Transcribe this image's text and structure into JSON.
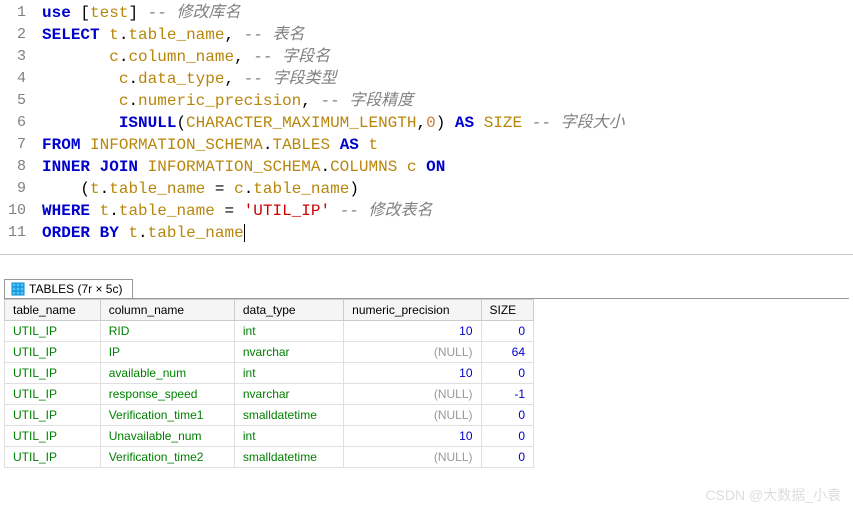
{
  "editor": {
    "lines": [
      {
        "n": 1,
        "tokens": [
          [
            "kw",
            "use "
          ],
          [
            "punct",
            "["
          ],
          [
            "ident",
            "test"
          ],
          [
            "punct",
            "] "
          ],
          [
            "comment",
            "-- 修改库名"
          ]
        ]
      },
      {
        "n": 2,
        "tokens": [
          [
            "kw",
            "SELECT "
          ],
          [
            "ident",
            "t"
          ],
          [
            "punct",
            "."
          ],
          [
            "ident",
            "table_name"
          ],
          [
            "punct",
            ", "
          ],
          [
            "comment",
            "-- 表名"
          ]
        ]
      },
      {
        "n": 3,
        "tokens": [
          [
            "punct",
            "       "
          ],
          [
            "ident",
            "c"
          ],
          [
            "punct",
            "."
          ],
          [
            "ident",
            "column_name"
          ],
          [
            "punct",
            ", "
          ],
          [
            "comment",
            "-- 字段名"
          ]
        ]
      },
      {
        "n": 4,
        "tokens": [
          [
            "punct",
            "        "
          ],
          [
            "ident",
            "c"
          ],
          [
            "punct",
            "."
          ],
          [
            "ident",
            "data_type"
          ],
          [
            "punct",
            ", "
          ],
          [
            "comment",
            "-- 字段类型"
          ]
        ]
      },
      {
        "n": 5,
        "tokens": [
          [
            "punct",
            "        "
          ],
          [
            "ident",
            "c"
          ],
          [
            "punct",
            "."
          ],
          [
            "ident",
            "numeric_precision"
          ],
          [
            "punct",
            ", "
          ],
          [
            "comment",
            "-- 字段精度"
          ]
        ]
      },
      {
        "n": 6,
        "tokens": [
          [
            "punct",
            "        "
          ],
          [
            "kw",
            "ISNULL"
          ],
          [
            "punct",
            "("
          ],
          [
            "ident",
            "CHARACTER_MAXIMUM_LENGTH"
          ],
          [
            "punct",
            ","
          ],
          [
            "num",
            "0"
          ],
          [
            "punct",
            ") "
          ],
          [
            "kw",
            "AS "
          ],
          [
            "ident",
            "SIZE "
          ],
          [
            "comment",
            "-- 字段大小"
          ]
        ]
      },
      {
        "n": 7,
        "tokens": [
          [
            "kw",
            "FROM "
          ],
          [
            "ident",
            "INFORMATION_SCHEMA"
          ],
          [
            "punct",
            "."
          ],
          [
            "ident",
            "TABLES "
          ],
          [
            "kw",
            "AS "
          ],
          [
            "ident",
            "t"
          ]
        ]
      },
      {
        "n": 8,
        "tokens": [
          [
            "kw",
            "INNER JOIN "
          ],
          [
            "ident",
            "INFORMATION_SCHEMA"
          ],
          [
            "punct",
            "."
          ],
          [
            "ident",
            "COLUMNS "
          ],
          [
            "ident",
            "c "
          ],
          [
            "kw",
            "ON"
          ]
        ]
      },
      {
        "n": 9,
        "tokens": [
          [
            "punct",
            "    ("
          ],
          [
            "ident",
            "t"
          ],
          [
            "punct",
            "."
          ],
          [
            "ident",
            "table_name "
          ],
          [
            "punct",
            "= "
          ],
          [
            "ident",
            "c"
          ],
          [
            "punct",
            "."
          ],
          [
            "ident",
            "table_name"
          ],
          [
            "punct",
            ")"
          ]
        ]
      },
      {
        "n": 10,
        "tokens": [
          [
            "kw",
            "WHERE "
          ],
          [
            "ident",
            "t"
          ],
          [
            "punct",
            "."
          ],
          [
            "ident",
            "table_name "
          ],
          [
            "punct",
            "= "
          ],
          [
            "str",
            "'UTIL_IP' "
          ],
          [
            "comment",
            "-- 修改表名"
          ]
        ]
      },
      {
        "n": 11,
        "tokens": [
          [
            "kw",
            "ORDER BY "
          ],
          [
            "ident",
            "t"
          ],
          [
            "punct",
            "."
          ],
          [
            "ident",
            "table_name"
          ]
        ]
      }
    ]
  },
  "results": {
    "tab_label": "TABLES (7r × 5c)",
    "columns": [
      "table_name",
      "column_name",
      "data_type",
      "numeric_precision",
      "SIZE"
    ],
    "rows": [
      [
        "UTIL_IP",
        "RID",
        "int",
        "10",
        "0"
      ],
      [
        "UTIL_IP",
        "IP",
        "nvarchar",
        "(NULL)",
        "64"
      ],
      [
        "UTIL_IP",
        "available_num",
        "int",
        "10",
        "0"
      ],
      [
        "UTIL_IP",
        "response_speed",
        "nvarchar",
        "(NULL)",
        "-1"
      ],
      [
        "UTIL_IP",
        "Verification_time1",
        "smalldatetime",
        "(NULL)",
        "0"
      ],
      [
        "UTIL_IP",
        "Unavailable_num",
        "int",
        "10",
        "0"
      ],
      [
        "UTIL_IP",
        "Verification_time2",
        "smalldatetime",
        "(NULL)",
        "0"
      ]
    ]
  },
  "watermark": "CSDN @大数据_小袁"
}
